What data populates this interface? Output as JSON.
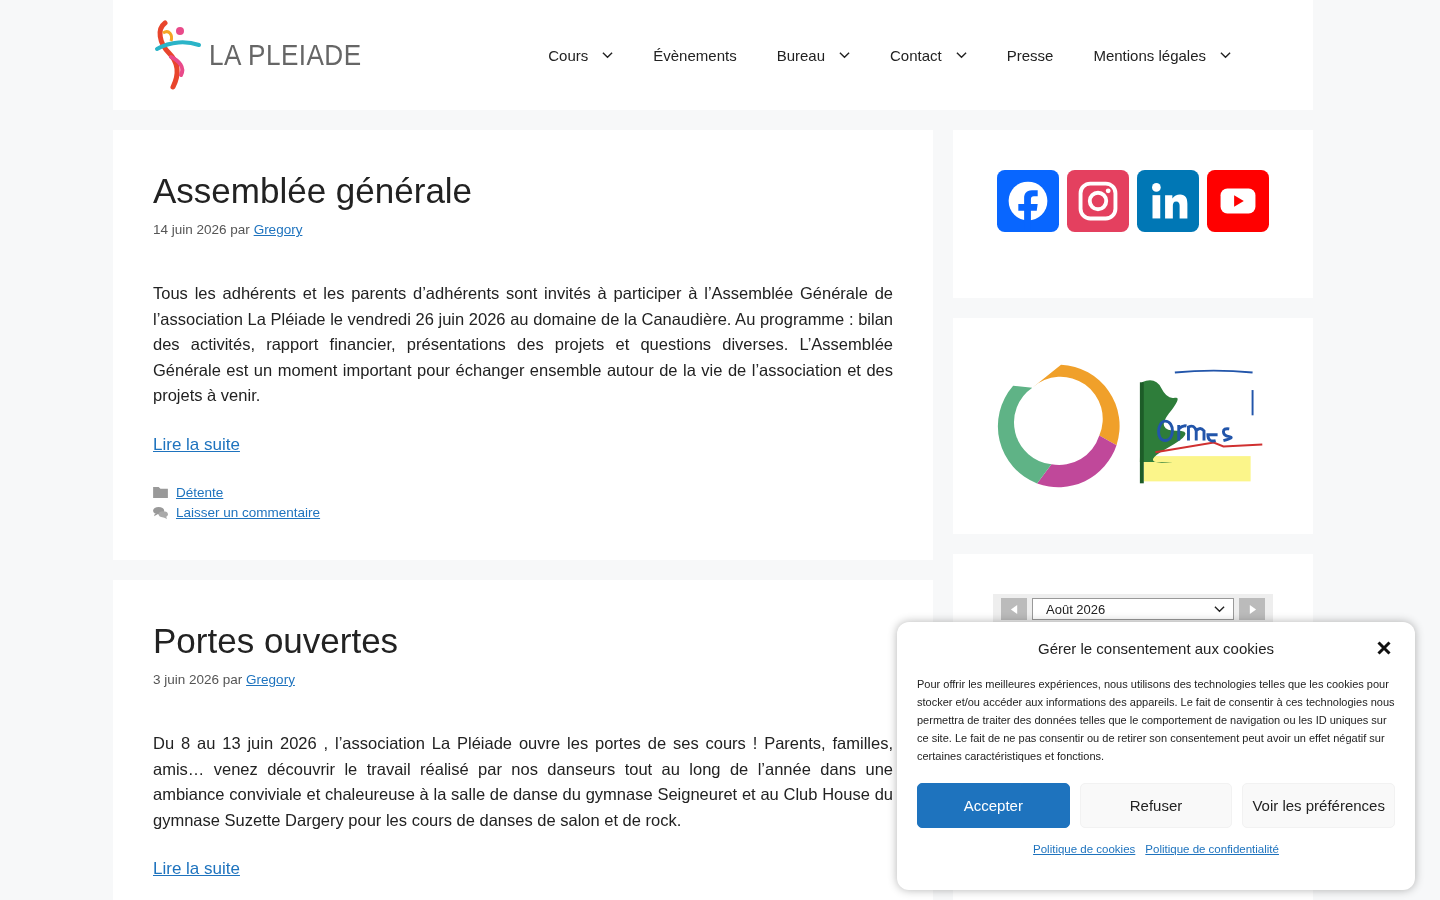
{
  "header": {
    "logo_text": "LA PLEIADE",
    "nav": [
      {
        "label": "Cours",
        "has_submenu": true
      },
      {
        "label": "Évènements",
        "has_submenu": false
      },
      {
        "label": "Bureau",
        "has_submenu": true
      },
      {
        "label": "Contact",
        "has_submenu": true
      },
      {
        "label": "Presse",
        "has_submenu": false
      },
      {
        "label": "Mentions légales",
        "has_submenu": true
      }
    ]
  },
  "posts": [
    {
      "title": "Assemblée générale",
      "date": "14 juin 2026",
      "by": "par",
      "author": "Gregory",
      "body": "Tous les adhérents et les parents d’adhérents sont invités à participer à l’Assemblée Générale de l’association La Pléiade le vendredi 26 juin 2026 au domaine de la Canaudière. Au programme : bilan des activités, rapport financier, présentations des projets et questions diverses. L’Assemblée Générale est un moment important pour échanger ensemble autour de la vie de l’association et des projets à venir.",
      "read_more": "Lire la suite",
      "category": "Détente",
      "comment_link": "Laisser un commentaire"
    },
    {
      "title": "Portes ouvertes",
      "date": "3 juin 2026",
      "by": "par",
      "author": "Gregory",
      "body": "Du 8 au 13 juin 2026 , l’association La Pléiade ouvre les portes de ses cours ! Parents, familles, amis… venez découvrir le travail réalisé par nos danseurs tout au long de l’année dans une ambiance conviviale et chaleureuse à la salle de danse du gymnase Seigneuret et au Club House du gymnase Suzette Dargery pour les cours de danses de salon et de rock.",
      "read_more": "Lire la suite"
    }
  ],
  "sidebar": {
    "social": [
      {
        "kind": "facebook"
      },
      {
        "kind": "instagram"
      },
      {
        "kind": "linkedin"
      },
      {
        "kind": "youtube"
      }
    ],
    "calendar": {
      "month": "Août 2026"
    }
  },
  "cookie_dialog": {
    "title": "Gérer le consentement aux cookies",
    "text": "Pour offrir les meilleures expériences, nous utilisons des technologies telles que les cookies pour stocker et/ou accéder aux informations des appareils. Le fait de consentir à ces technologies nous permettra de traiter des données telles que le comportement de navigation ou les ID uniques sur ce site. Le fait de ne pas consentir ou de retirer son consentement peut avoir un effet négatif sur certaines caractéristiques et fonctions.",
    "buttons": [
      {
        "label": "Accepter",
        "kind": "primary"
      },
      {
        "label": "Refuser",
        "kind": "secondary"
      },
      {
        "label": "Voir les préférences",
        "kind": "secondary"
      }
    ],
    "links": [
      "Politique de cookies",
      "Politique de confidentialité"
    ]
  }
}
